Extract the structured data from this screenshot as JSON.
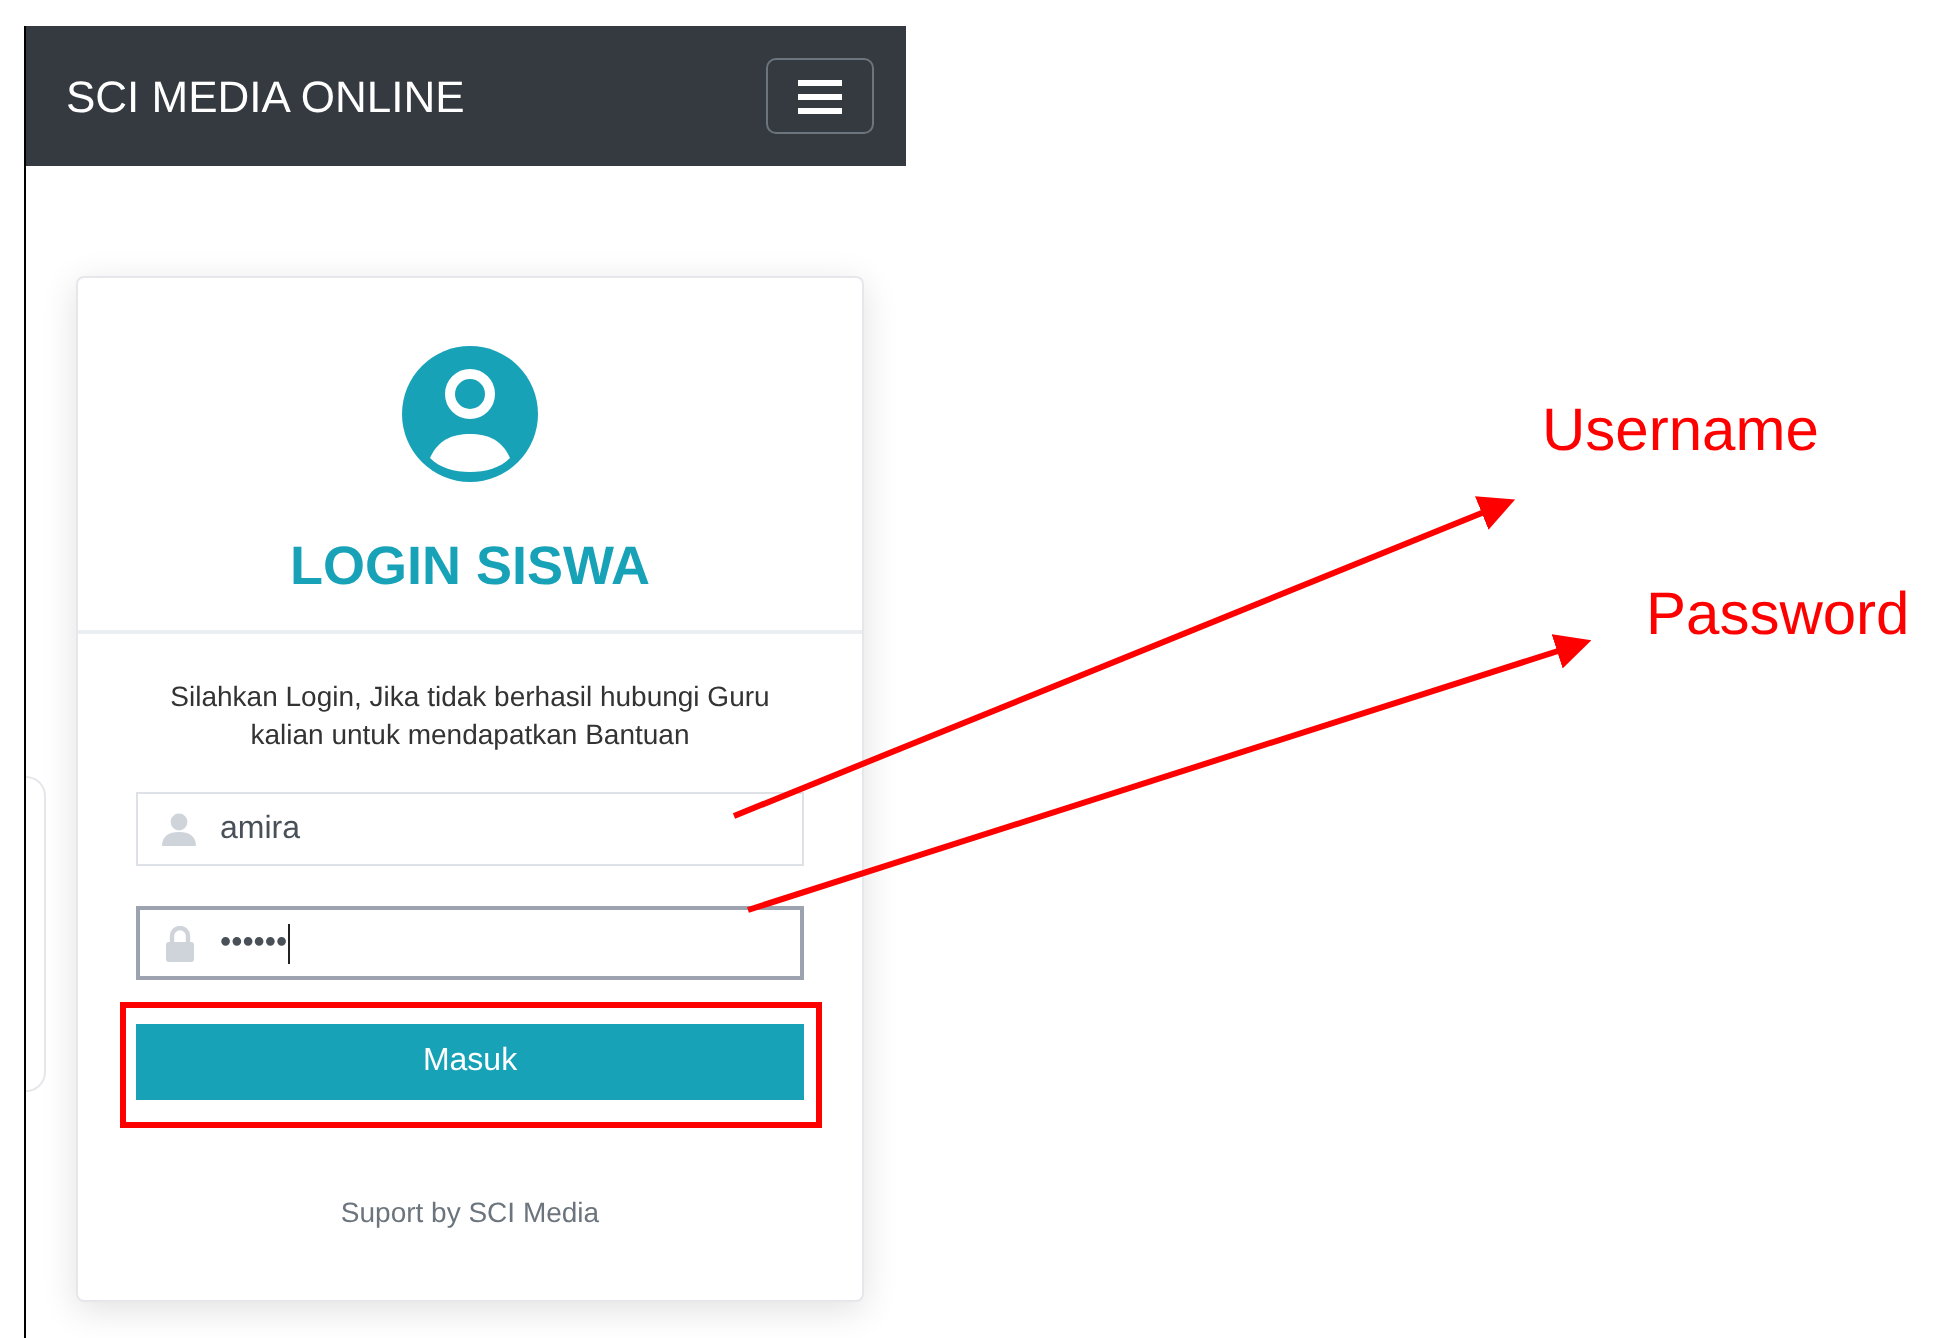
{
  "navbar": {
    "title": "SCI MEDIA ONLINE"
  },
  "login_card": {
    "heading": "LOGIN SISWA",
    "instructions": "Silahkan Login, Jika tidak berhasil hubungi Guru kalian untuk mendapatkan Bantuan",
    "username_field": {
      "value": "amira",
      "focused": false
    },
    "password_field": {
      "value": "••••••",
      "focused": true
    },
    "submit_button": {
      "label": "Masuk",
      "highlighted": true
    },
    "footer": "Suport by SCI Media"
  },
  "annotations": [
    {
      "kind": "arrow",
      "label": "Username"
    },
    {
      "kind": "arrow",
      "label": "Password"
    }
  ]
}
